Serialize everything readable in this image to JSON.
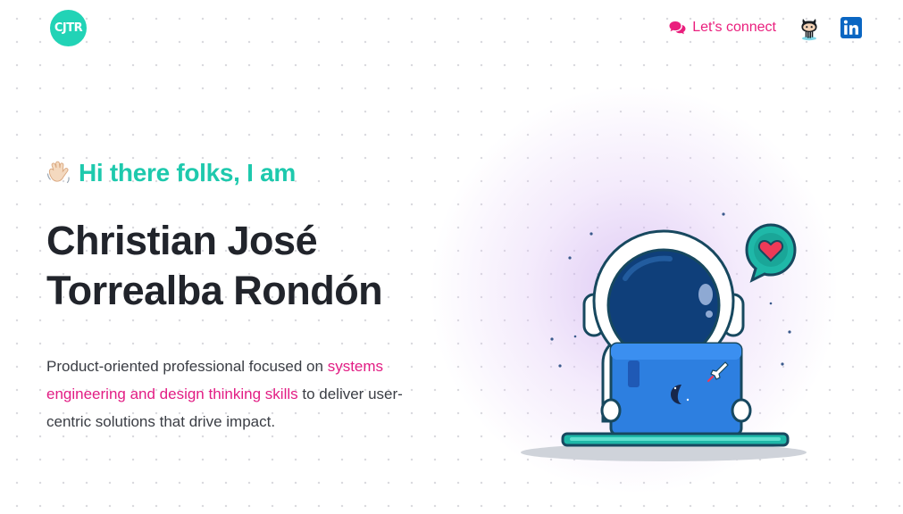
{
  "header": {
    "logo_text": "CJTR",
    "connect_label": "Let's connect",
    "github_icon": "github-octocat-icon",
    "linkedin_icon": "linkedin-icon"
  },
  "hero": {
    "wave_icon": "waving-hand-icon",
    "greeting": "Hi there folks, I am",
    "name_line1": "Christian José",
    "name_line2": "Torrealba Rondón",
    "tagline_part1": "Product-oriented professional focused on ",
    "tagline_highlight": "systems engineering and design thinking skills",
    "tagline_part2": " to deliver user-centric solutions that drive impact."
  },
  "colors": {
    "accent_teal": "#1ec9ad",
    "accent_pink": "#ea1e7d",
    "text_dark": "#21242b"
  },
  "illustration": {
    "icon": "astronaut-laptop-illustration"
  }
}
